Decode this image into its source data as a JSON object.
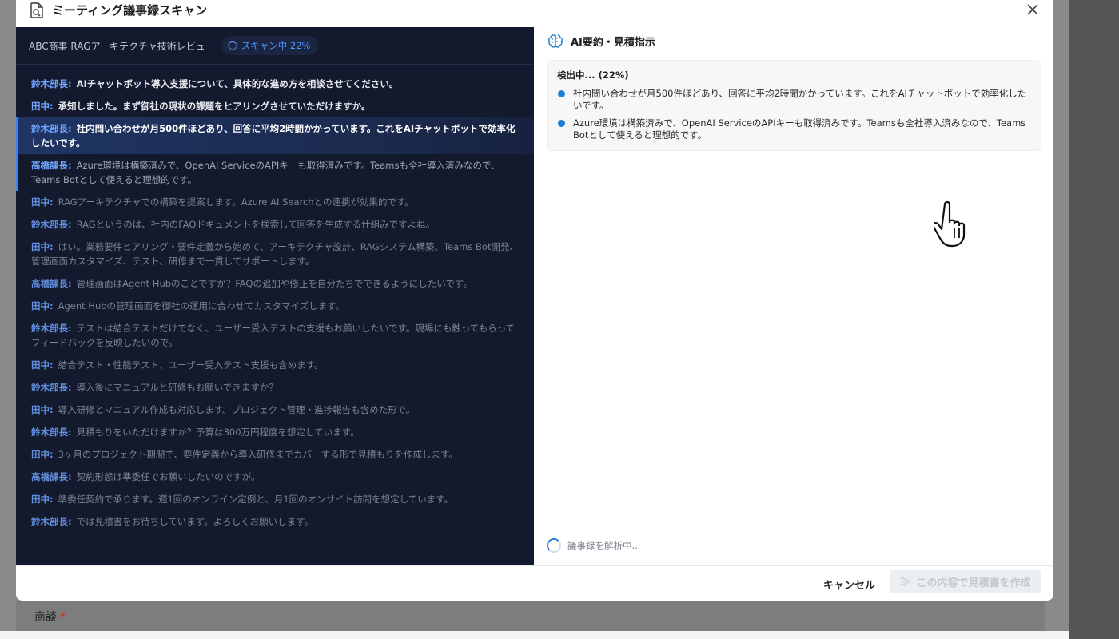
{
  "modal": {
    "title": "ミーティング議事録スキャン",
    "cancel_label": "キャンセル",
    "create_label": "この内容で見積書を作成"
  },
  "left": {
    "meeting_title": "ABC商事 RAGアーキテクチャ技術レビュー",
    "scan_status": "スキャン中 22%",
    "lines": [
      {
        "speaker": "鈴木部長:",
        "text": "AIチャットボット導入支援について、具体的な進め方を相談させてください。"
      },
      {
        "speaker": "田中:",
        "text": "承知しました。まず御社の現状の課題をヒアリングさせていただけますか。"
      },
      {
        "speaker": "鈴木部長:",
        "text": "社内問い合わせが月500件ほどあり、回答に平均2時間かかっています。これをAIチャットボットで効率化したいです。"
      },
      {
        "speaker": "高橋課長:",
        "text": "Azure環境は構築済みで、OpenAI ServiceのAPIキーも取得済みです。Teamsも全社導入済みなので、Teams Botとして使えると理想的です。"
      },
      {
        "speaker": "田中:",
        "text": "RAGアーキテクチャでの構築を提案します。Azure AI Searchとの連携が効果的です。"
      },
      {
        "speaker": "鈴木部長:",
        "text": "RAGというのは、社内のFAQドキュメントを検索して回答を生成する仕組みですよね。"
      },
      {
        "speaker": "田中:",
        "text": "はい。業務要件ヒアリング・要件定義から始めて、アーキテクチャ設計、RAGシステム構築、Teams Bot開発、管理画面カスタマイズ、テスト、研修まで一貫してサポートします。"
      },
      {
        "speaker": "高橋課長:",
        "text": "管理画面はAgent Hubのことですか？FAQの追加や修正を自分たちでできるようにしたいです。"
      },
      {
        "speaker": "田中:",
        "text": "Agent Hubの管理画面を御社の運用に合わせてカスタマイズします。"
      },
      {
        "speaker": "鈴木部長:",
        "text": "テストは結合テストだけでなく、ユーザー受入テストの支援もお願いしたいです。現場にも触ってもらってフィードバックを反映したいので。"
      },
      {
        "speaker": "田中:",
        "text": "結合テスト・性能テスト、ユーザー受入テスト支援も含めます。"
      },
      {
        "speaker": "鈴木部長:",
        "text": "導入後にマニュアルと研修もお願いできますか？"
      },
      {
        "speaker": "田中:",
        "text": "導入研修とマニュアル作成も対応します。プロジェクト管理・進捗報告も含めた形で。"
      },
      {
        "speaker": "鈴木部長:",
        "text": "見積もりをいただけますか？予算は300万円程度を想定しています。"
      },
      {
        "speaker": "田中:",
        "text": "3ヶ月のプロジェクト期間で、要件定義から導入研修までカバーする形で見積もりを作成します。"
      },
      {
        "speaker": "高橋課長:",
        "text": "契約形態は準委任でお願いしたいのですが。"
      },
      {
        "speaker": "田中:",
        "text": "準委任契約で承ります。週1回のオンライン定例と、月1回のオンサイト訪問を想定しています。"
      },
      {
        "speaker": "鈴木部長:",
        "text": "では見積書をお待ちしています。よろしくお願いします。"
      }
    ]
  },
  "right": {
    "title": "AI要約・見積指示",
    "detect_status": "検出中... (22%)",
    "bullets": [
      "社内問い合わせが月500件ほどあり、回答に平均2時間かかっています。これをAIチャットボットで効率化したいです。",
      "Azure環境は構築済みで、OpenAI ServiceのAPIキーも取得済みです。Teamsも全社導入済みなので、Teams Botとして使えると理想的です。"
    ],
    "parsing_text": "議事録を解析中..."
  },
  "background": {
    "form_label": "商談",
    "required_mark": "*"
  },
  "colors": {
    "panel_dark": "#141a2e",
    "accent_blue": "#3b82f6",
    "bullet_blue": "#1a7fd4"
  }
}
